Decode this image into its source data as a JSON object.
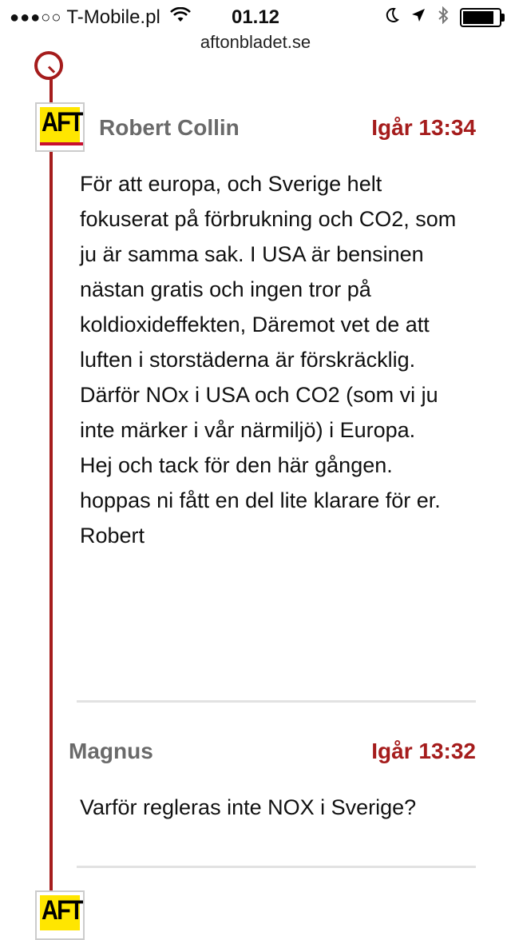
{
  "status_bar": {
    "signal_dots": "●●●○○",
    "carrier": "T-Mobile.pl",
    "time": "01.12",
    "battery_level": 0.9
  },
  "url": "aftonbladet.se",
  "comments": [
    {
      "author": "Robert Collin",
      "time": "Igår 13:34",
      "avatar_text": "AFT",
      "lines": [
        "För att europa, och Sverige helt fokuserat på förbrukning och CO2, som ju är samma sak. I USA är bensinen nästan gratis och ingen tror på koldioxideffekten, Däremot vet de att luften i storstäderna är förskräcklig. Därför NOx i USA och CO2 (som vi ju inte märker i vår närmiljö) i Europa.",
        "Hej och tack för den här gången. hoppas ni fått en del lite klarare för er.",
        "Robert"
      ]
    },
    {
      "author": "Magnus",
      "time": "Igår 13:32",
      "lines": [
        "Varför regleras inte NOX i Sverige?"
      ]
    }
  ],
  "next_avatar_text": "AFT"
}
